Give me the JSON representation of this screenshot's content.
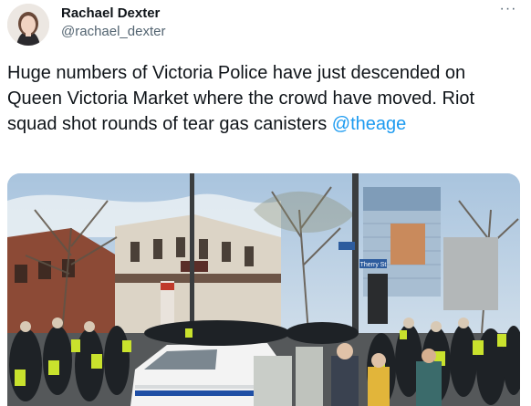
{
  "tweet": {
    "author": {
      "display_name": "Rachael Dexter",
      "handle": "@rachael_dexter"
    },
    "more_icon": "more-horizontal-icon",
    "more_label": "···",
    "text": "Huge numbers of Victoria Police have just descended on Queen Victoria Market where the crowd have moved. Riot squad shot rounds of tear gas canisters ",
    "mention": "@theage",
    "media": {
      "type": "photo",
      "street_sign": "Elizabeth St",
      "street_sign_secondary": "Therry St"
    }
  },
  "colors": {
    "text": "#0f1419",
    "secondary": "#536471",
    "link": "#1d9bf0",
    "police_vest": "#c9e22d"
  }
}
